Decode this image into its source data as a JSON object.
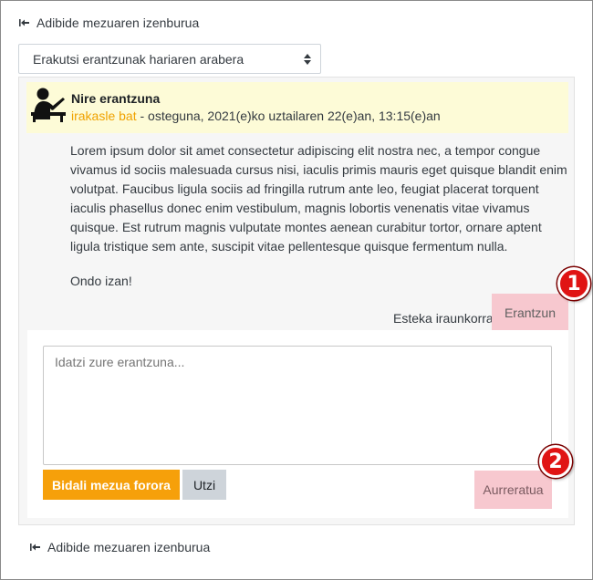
{
  "nav": {
    "top_link_label": "Adibide mezuaren izenburua",
    "bottom_link_label": "Adibide mezuaren izenburua"
  },
  "sort": {
    "selected": "Erakutsi erantzunak hariaren arabera"
  },
  "post": {
    "title": "Nire erantzuna",
    "author": "irakasle bat",
    "date": " - osteguna, 2021(e)ko uztailaren 22(e)an, 13:15(e)an",
    "body": "Lorem ipsum dolor sit amet consectetur adipiscing elit nostra nec, a tempor congue vivamus id sociis malesuada cursus nisi, iaculis primis mauris eget quisque blandit enim volutpat. Faucibus ligula sociis ad fringilla rutrum ante leo, feugiat placerat torquent iaculis phasellus donec enim vestibulum, magnis lobortis venenatis vitae vivamus quisque. Est rutrum magnis vulputate montes aenean curabitur tortor, ornare aptent ligula tristique sem ante, suscipit vitae pellentesque quisque fermentum nulla.",
    "signature": "Ondo izan!",
    "permalink_label": "Esteka iraunkorra",
    "reply_label": "Erantzun"
  },
  "reply_form": {
    "placeholder": "Idatzi zure erantzuna...",
    "submit_label": "Bidali mezua forora",
    "cancel_label": "Utzi",
    "advanced_label": "Aurreratua"
  },
  "callouts": [
    "1",
    "2"
  ],
  "colors": {
    "accent": "#f6a00a",
    "author_link": "#f0a200",
    "highlight": "#f7c8cf",
    "header_bg": "#fdfbd7",
    "badge": "#e01414"
  }
}
